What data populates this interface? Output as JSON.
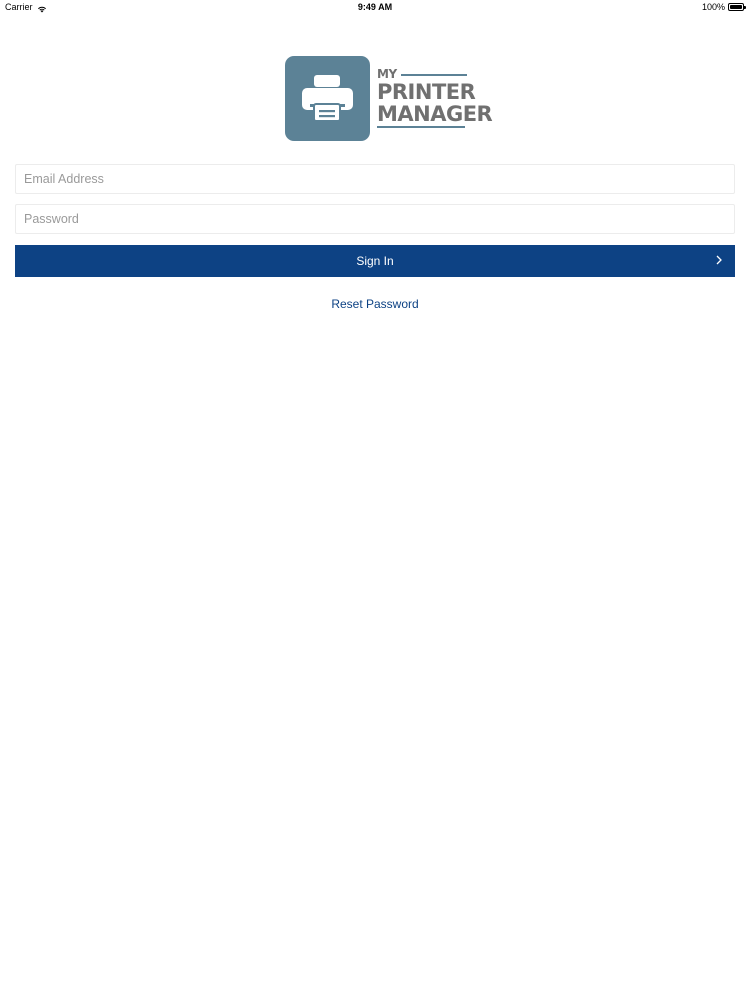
{
  "status_bar": {
    "carrier": "Carrier",
    "time": "9:49 AM",
    "battery": "100%",
    "icons": [
      "wifi-icon",
      "battery-icon"
    ]
  },
  "logo": {
    "line1": "MY",
    "line2": "PRINTER",
    "line3": "MANAGER",
    "icon": "printer-icon",
    "tile_color": "#5c8296"
  },
  "form": {
    "email_placeholder": "Email Address",
    "password_placeholder": "Password",
    "sign_in_label": "Sign In",
    "sign_in_icon": "chevron-right-icon",
    "reset_password_label": "Reset Password"
  },
  "colors": {
    "primary": "#0d4284",
    "field_border": "#ececec",
    "logo_tile": "#5c8296",
    "logo_text": "#707070"
  }
}
